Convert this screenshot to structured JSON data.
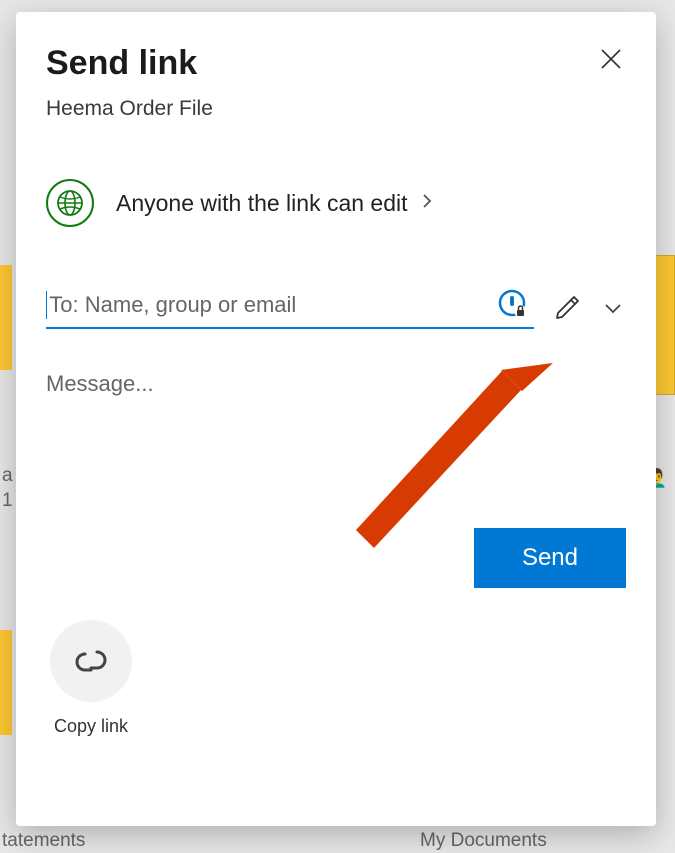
{
  "dialog": {
    "title": "Send link",
    "subtitle": "Heema Order File",
    "link_settings_label": "Anyone with the link can edit",
    "to_placeholder": "To: Name, group or email",
    "message_placeholder": "Message...",
    "send_label": "Send",
    "copy_link_label": "Copy link"
  },
  "background": {
    "bottom_left_text": "tatements",
    "bottom_right_text": "My Documents",
    "left_char": "a",
    "left_num": "1"
  }
}
